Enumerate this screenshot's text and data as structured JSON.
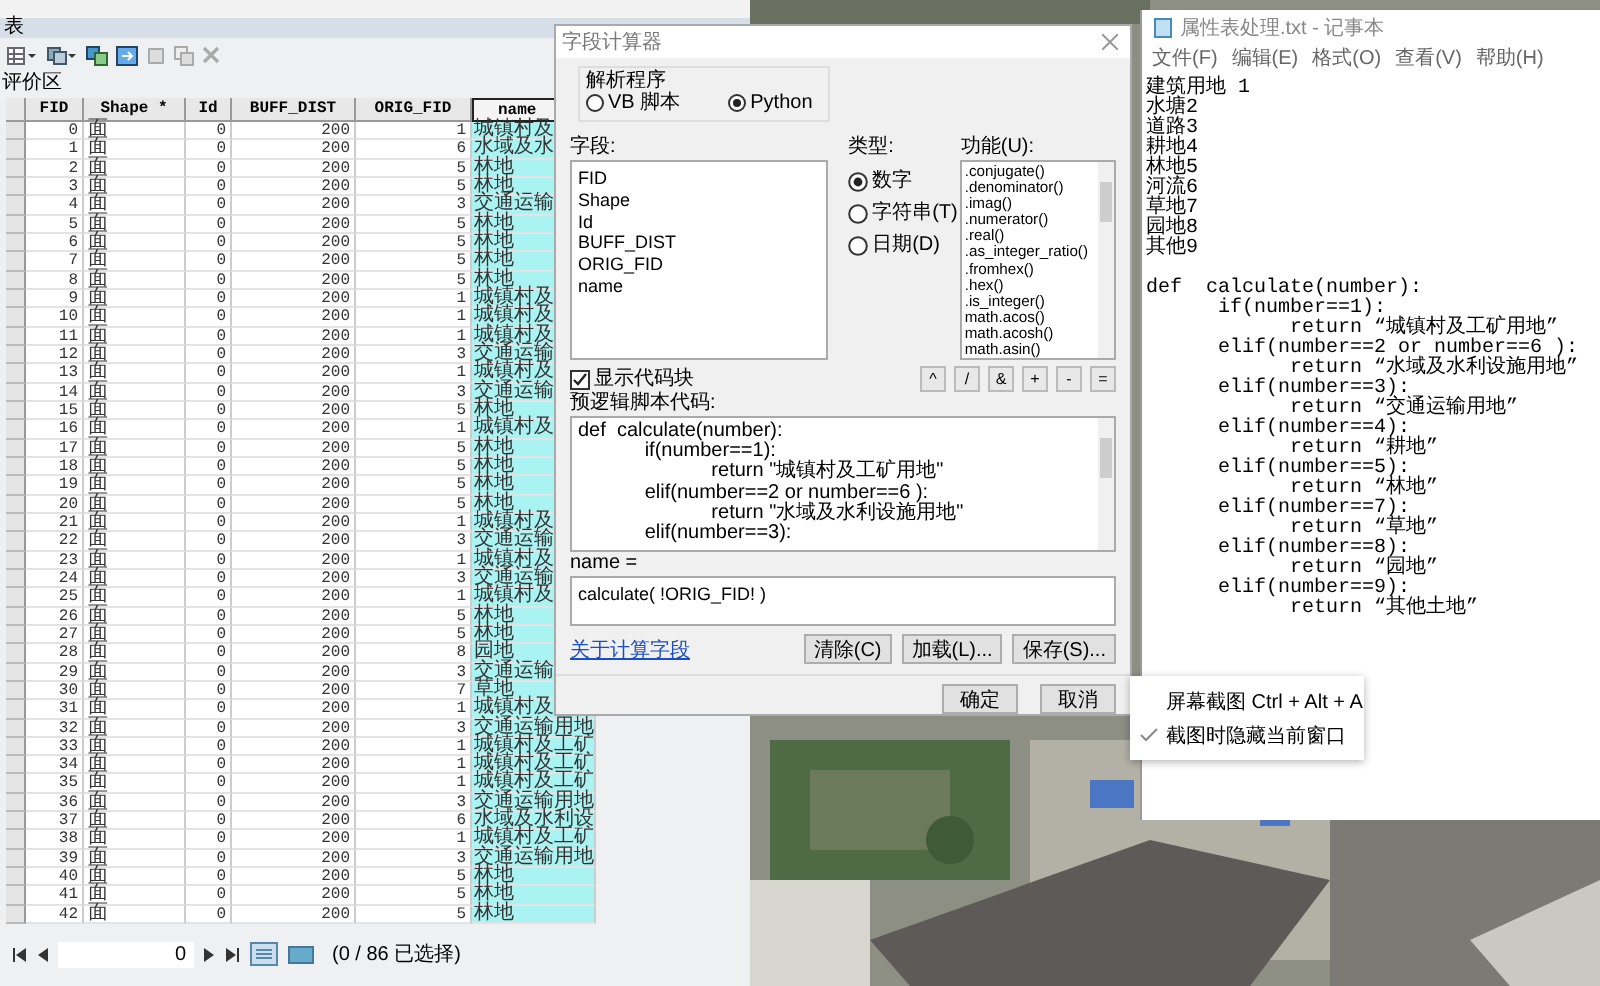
{
  "table_window": {
    "title": "表",
    "layer_tab": "评价区",
    "columns": [
      {
        "label": "FID",
        "kind": "number",
        "selected": false
      },
      {
        "label": "Shape *",
        "kind": "text",
        "selected": false
      },
      {
        "label": "Id",
        "kind": "number",
        "selected": false
      },
      {
        "label": "BUFF_DIST",
        "kind": "number",
        "selected": false
      },
      {
        "label": "ORIG_FID",
        "kind": "number",
        "selected": false
      },
      {
        "label": "name",
        "kind": "text",
        "selected": true
      }
    ],
    "rows": [
      [
        "0",
        "面",
        "0",
        "200",
        "1",
        "城镇村及"
      ],
      [
        "1",
        "面",
        "0",
        "200",
        "6",
        "水域及水"
      ],
      [
        "2",
        "面",
        "0",
        "200",
        "5",
        "林地"
      ],
      [
        "3",
        "面",
        "0",
        "200",
        "5",
        "林地"
      ],
      [
        "4",
        "面",
        "0",
        "200",
        "3",
        "交通运输"
      ],
      [
        "5",
        "面",
        "0",
        "200",
        "5",
        "林地"
      ],
      [
        "6",
        "面",
        "0",
        "200",
        "5",
        "林地"
      ],
      [
        "7",
        "面",
        "0",
        "200",
        "5",
        "林地"
      ],
      [
        "8",
        "面",
        "0",
        "200",
        "5",
        "林地"
      ],
      [
        "9",
        "面",
        "0",
        "200",
        "1",
        "城镇村及"
      ],
      [
        "10",
        "面",
        "0",
        "200",
        "1",
        "城镇村及"
      ],
      [
        "11",
        "面",
        "0",
        "200",
        "1",
        "城镇村及"
      ],
      [
        "12",
        "面",
        "0",
        "200",
        "3",
        "交通运输"
      ],
      [
        "13",
        "面",
        "0",
        "200",
        "1",
        "城镇村及"
      ],
      [
        "14",
        "面",
        "0",
        "200",
        "3",
        "交通运输"
      ],
      [
        "15",
        "面",
        "0",
        "200",
        "5",
        "林地"
      ],
      [
        "16",
        "面",
        "0",
        "200",
        "1",
        "城镇村及"
      ],
      [
        "17",
        "面",
        "0",
        "200",
        "5",
        "林地"
      ],
      [
        "18",
        "面",
        "0",
        "200",
        "5",
        "林地"
      ],
      [
        "19",
        "面",
        "0",
        "200",
        "5",
        "林地"
      ],
      [
        "20",
        "面",
        "0",
        "200",
        "5",
        "林地"
      ],
      [
        "21",
        "面",
        "0",
        "200",
        "1",
        "城镇村及"
      ],
      [
        "22",
        "面",
        "0",
        "200",
        "3",
        "交通运输"
      ],
      [
        "23",
        "面",
        "0",
        "200",
        "1",
        "城镇村及"
      ],
      [
        "24",
        "面",
        "0",
        "200",
        "3",
        "交通运输"
      ],
      [
        "25",
        "面",
        "0",
        "200",
        "1",
        "城镇村及"
      ],
      [
        "26",
        "面",
        "0",
        "200",
        "5",
        "林地"
      ],
      [
        "27",
        "面",
        "0",
        "200",
        "5",
        "林地"
      ],
      [
        "28",
        "面",
        "0",
        "200",
        "8",
        "园地"
      ],
      [
        "29",
        "面",
        "0",
        "200",
        "3",
        "交通运输"
      ],
      [
        "30",
        "面",
        "0",
        "200",
        "7",
        "草地"
      ],
      [
        "31",
        "面",
        "0",
        "200",
        "1",
        "城镇村及"
      ],
      [
        "32",
        "面",
        "0",
        "200",
        "3",
        "交通运输用地"
      ],
      [
        "33",
        "面",
        "0",
        "200",
        "1",
        "城镇村及工矿"
      ],
      [
        "34",
        "面",
        "0",
        "200",
        "1",
        "城镇村及工矿"
      ],
      [
        "35",
        "面",
        "0",
        "200",
        "1",
        "城镇村及工矿"
      ],
      [
        "36",
        "面",
        "0",
        "200",
        "3",
        "交通运输用地"
      ],
      [
        "37",
        "面",
        "0",
        "200",
        "6",
        "水域及水利设"
      ],
      [
        "38",
        "面",
        "0",
        "200",
        "1",
        "城镇村及工矿"
      ],
      [
        "39",
        "面",
        "0",
        "200",
        "3",
        "交通运输用地"
      ],
      [
        "40",
        "面",
        "0",
        "200",
        "5",
        "林地"
      ],
      [
        "41",
        "面",
        "0",
        "200",
        "5",
        "林地"
      ],
      [
        "42",
        "面",
        "0",
        "200",
        "5",
        "林地"
      ]
    ],
    "nav": {
      "record": "0",
      "status": "(0 / 86 已选择)"
    }
  },
  "field_calculator": {
    "title": "字段计算器",
    "parser": {
      "label": "解析程序",
      "options": [
        {
          "label": "VB 脚本",
          "selected": false
        },
        {
          "label": "Python",
          "selected": true
        }
      ]
    },
    "fields_label": "字段:",
    "fields": [
      "FID",
      "Shape",
      "Id",
      "BUFF_DIST",
      "ORIG_FID",
      "name"
    ],
    "type_label": "类型:",
    "types": [
      {
        "label": "数字",
        "selected": true
      },
      {
        "label": "字符串(T)",
        "selected": false
      },
      {
        "label": "日期(D)",
        "selected": false
      }
    ],
    "functions_label": "功能(U):",
    "functions": [
      ".conjugate()",
      ".denominator()",
      ".imag()",
      ".numerator()",
      ".real()",
      ".as_integer_ratio()",
      ".fromhex()",
      ".hex()",
      ".is_integer()",
      "math.acos()",
      "math.acosh()",
      "math.asin()"
    ],
    "show_codeblock": {
      "label": "显示代码块",
      "checked": true
    },
    "operators": [
      "^",
      "/",
      "&",
      "+",
      "-",
      "="
    ],
    "codeblock_label": "预逻辑脚本代码:",
    "codeblock": [
      "def  calculate(number):",
      "            if(number==1):",
      "                        return \"城镇村及工矿用地\"",
      "            elif(number==2 or number==6 ):",
      "                        return \"水域及水利设施用地\"",
      "            elif(number==3):"
    ],
    "expression_label": "name =",
    "expression": "calculate( !ORIG_FID! )",
    "help_link": "关于计算字段",
    "buttons": [
      "清除(C)",
      "加载(L)...",
      "保存(S)..."
    ],
    "ok": "确定",
    "cancel": "取消"
  },
  "notepad": {
    "title": "属性表处理.txt - 记事本",
    "menu": [
      "文件(F)",
      "编辑(E)",
      "格式(O)",
      "查看(V)",
      "帮助(H)"
    ],
    "codes": [
      "建筑用地 1",
      "水塘2",
      "道路3",
      "耕地4",
      "林地5",
      "河流6",
      "草地7",
      "园地8",
      "其他9"
    ],
    "script": [
      "def  calculate(number):",
      "      if(number==1):",
      "            return “城镇村及工矿用地”",
      "      elif(number==2 or number==6 ):",
      "            return “水域及水利设施用地”",
      "      elif(number==3):",
      "            return “交通运输用地”",
      "      elif(number==4):",
      "            return “耕地”",
      "      elif(number==5):",
      "            return “林地”",
      "      elif(number==7):",
      "            return “草地”",
      "      elif(number==8):",
      "            return “园地”",
      "      elif(number==9):",
      "            return “其他土地”"
    ]
  },
  "context_menu": {
    "items": [
      {
        "label": "屏幕截图 Ctrl + Alt + A",
        "checked": false
      },
      {
        "label": "截图时隐藏当前窗口",
        "checked": true
      }
    ]
  }
}
